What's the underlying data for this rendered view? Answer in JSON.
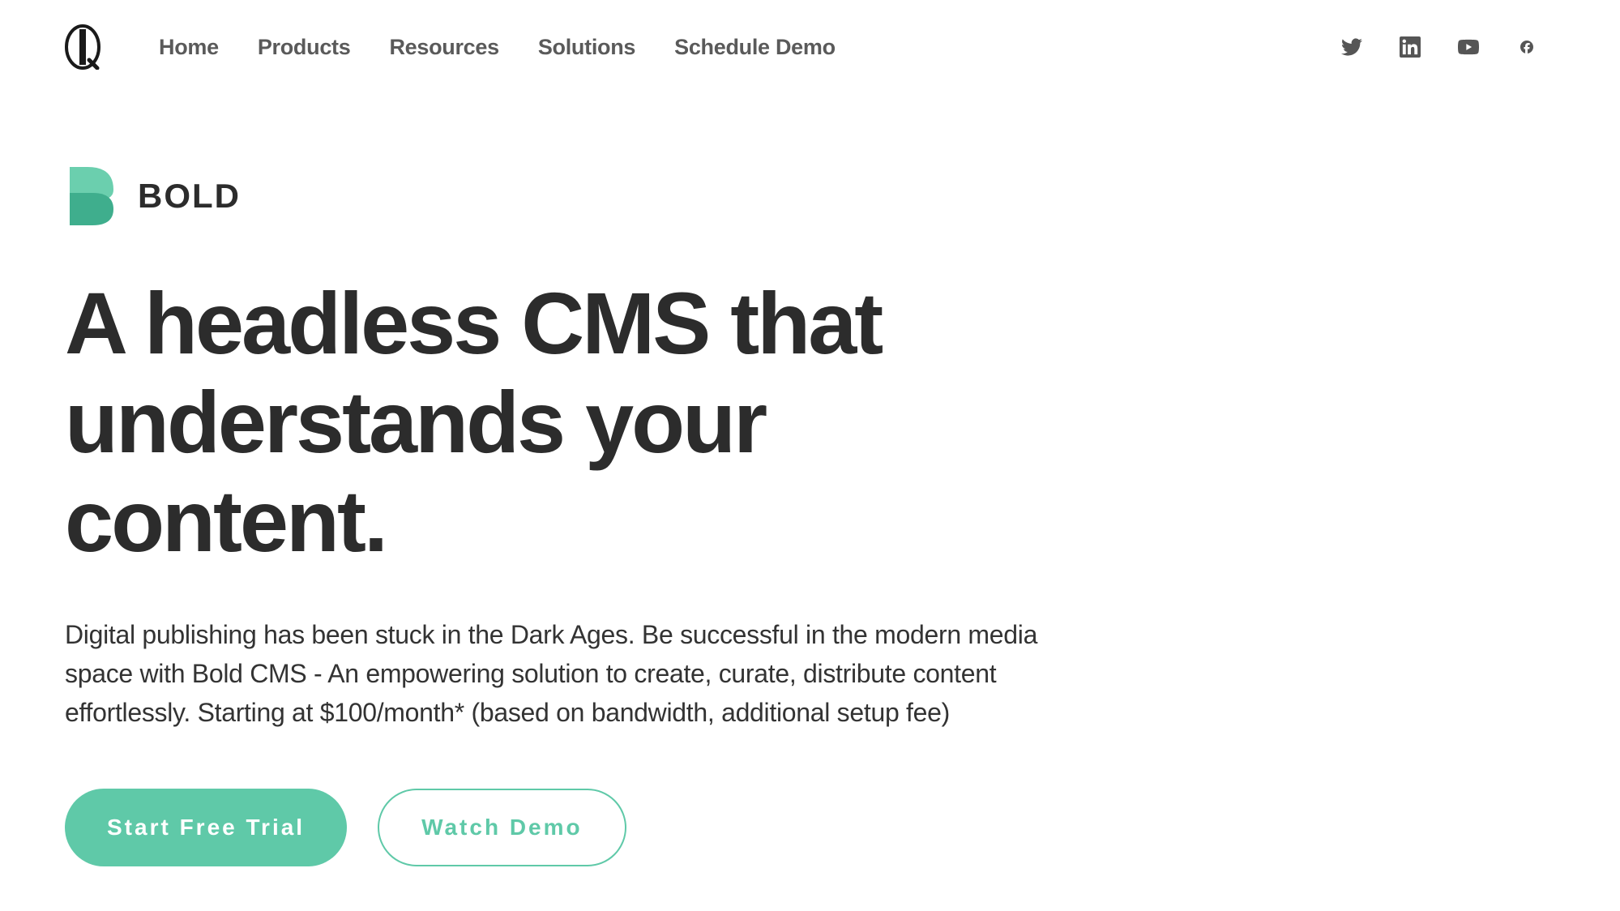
{
  "nav": {
    "items": [
      {
        "label": "Home"
      },
      {
        "label": "Products"
      },
      {
        "label": "Resources"
      },
      {
        "label": "Solutions"
      },
      {
        "label": "Schedule Demo"
      }
    ]
  },
  "social": {
    "icons": [
      "twitter",
      "linkedin",
      "youtube",
      "facebook"
    ]
  },
  "hero": {
    "brand": "BOLD",
    "headline": "A headless CMS that understands your content.",
    "subtext": "Digital publishing has been stuck in the Dark Ages. Be successful in the modern media space with Bold CMS - An empowering solution to create, curate, distribute content effortlessly. Starting at $100/month* (based on bandwidth, additional setup fee)",
    "cta_primary": "Start Free Trial",
    "cta_secondary": "Watch Demo"
  },
  "colors": {
    "accent": "#5fc9a8",
    "text_dark": "#2c2c2c",
    "nav_text": "#5a5a5a"
  }
}
